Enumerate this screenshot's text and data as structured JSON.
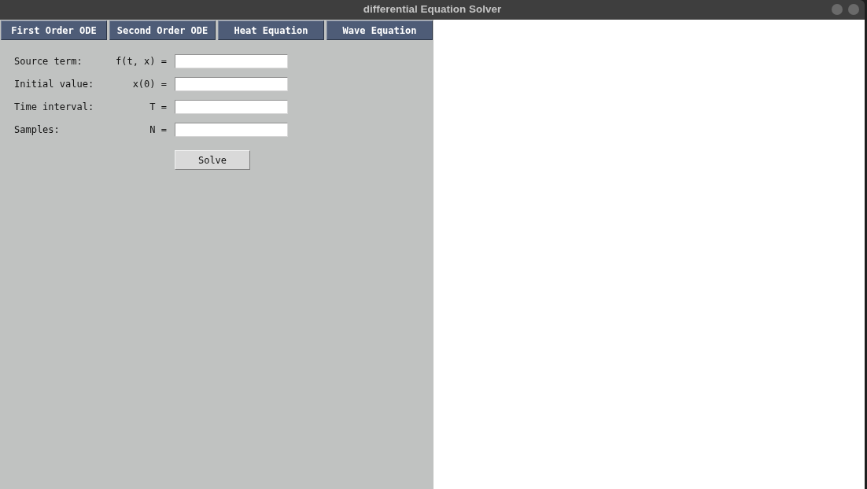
{
  "window": {
    "title": "differential Equation Solver"
  },
  "tabs": [
    {
      "label": "First Order ODE"
    },
    {
      "label": "Second Order ODE"
    },
    {
      "label": "Heat Equation"
    },
    {
      "label": "Wave Equation"
    }
  ],
  "form": {
    "fields": [
      {
        "label": "Source term:",
        "expression": "f(t, x) ="
      },
      {
        "label": "Initial value:",
        "expression": "x(0) ="
      },
      {
        "label": "Time interval:",
        "expression": "T ="
      },
      {
        "label": "Samples:",
        "expression": "N ="
      }
    ],
    "button": "Solve"
  }
}
